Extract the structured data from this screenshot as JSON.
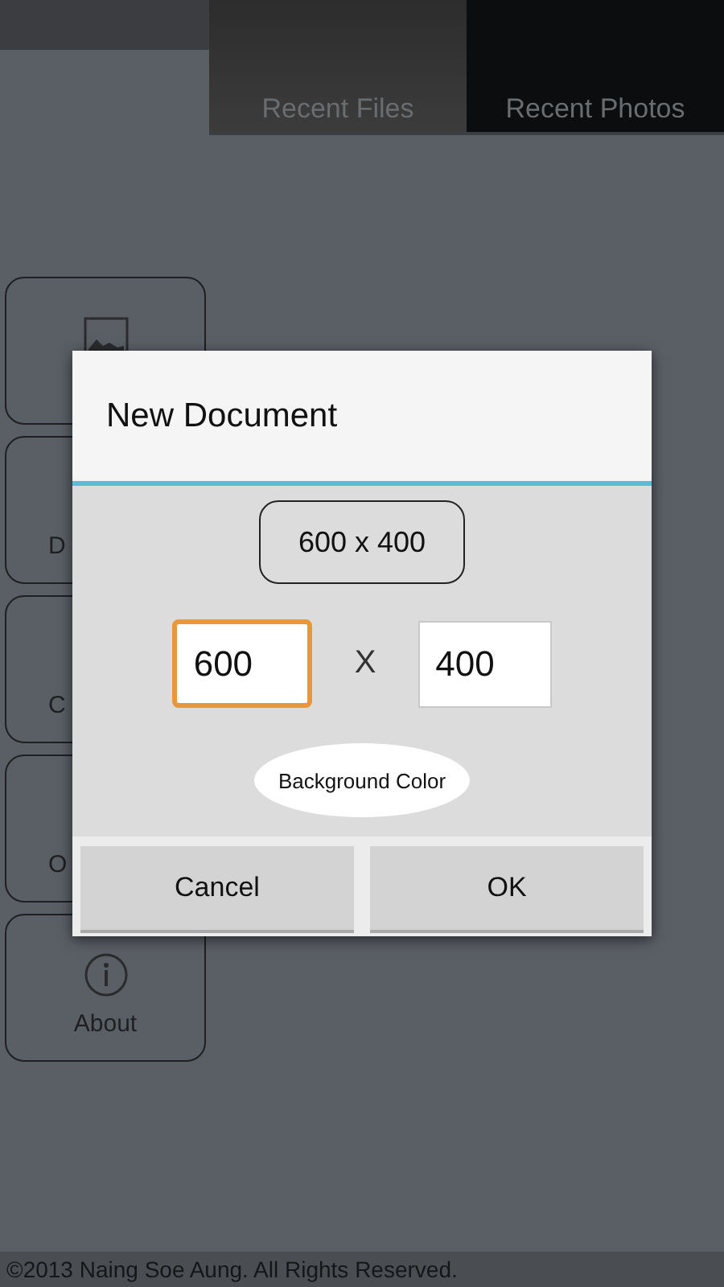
{
  "tabs": [
    {
      "label": "Recent Files",
      "selected": true
    },
    {
      "label": "Recent Photos",
      "selected": false
    }
  ],
  "sidebar": {
    "items": [
      {
        "kind": "image"
      },
      {
        "kind": "text",
        "label": "D"
      },
      {
        "kind": "text",
        "label": "C"
      },
      {
        "kind": "text",
        "label": "O"
      },
      {
        "kind": "info",
        "label": "About"
      }
    ]
  },
  "dialog": {
    "title": "New Document",
    "size_button": "600 x 400",
    "width": {
      "value": "600",
      "focused": true
    },
    "separator": "X",
    "height": {
      "value": "400",
      "focused": false
    },
    "color_button": "Background Color",
    "buttons": [
      "Cancel",
      "OK"
    ]
  },
  "footer": "©2013 Naing Soe Aung. All Rights Reserved."
}
